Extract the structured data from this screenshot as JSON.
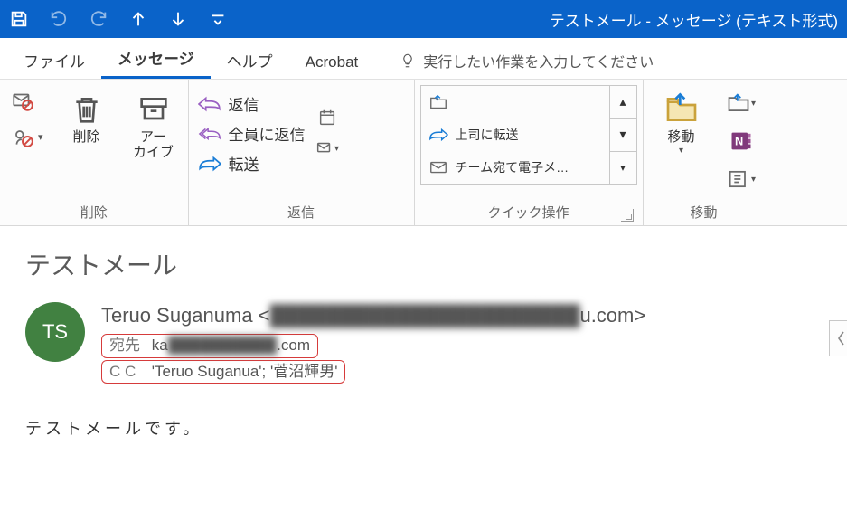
{
  "titlebar": {
    "title": "テストメール  -  メッセージ (テキスト形式)"
  },
  "tabs": {
    "file": "ファイル",
    "message": "メッセージ",
    "help": "ヘルプ",
    "acrobat": "Acrobat",
    "tellme": "実行したい作業を入力してください"
  },
  "ribbon": {
    "delete_group": "削除",
    "delete_big": "削除",
    "archive_l1": "アー",
    "archive_l2": "カイブ",
    "reply_group": "返信",
    "reply": "返信",
    "reply_all": "全員に返信",
    "forward": "転送",
    "quick_group": "クイック操作",
    "quick_item1": "　　　",
    "quick_item2": "上司に転送",
    "quick_item3": "チーム宛て電子メ…",
    "move_group": "移動",
    "move_big": "移動"
  },
  "reading": {
    "subject": "テストメール",
    "avatar": "TS",
    "from_name": "Teruo Suganuma <",
    "from_domain_vis": "u.com>",
    "to_label": "宛先",
    "to_prefix": "ka",
    "to_suffix": ".com",
    "cc_label": "C C",
    "cc_value": "'Teruo Suganua'; '菅沼輝男'"
  },
  "body_text": "テストメールです。"
}
